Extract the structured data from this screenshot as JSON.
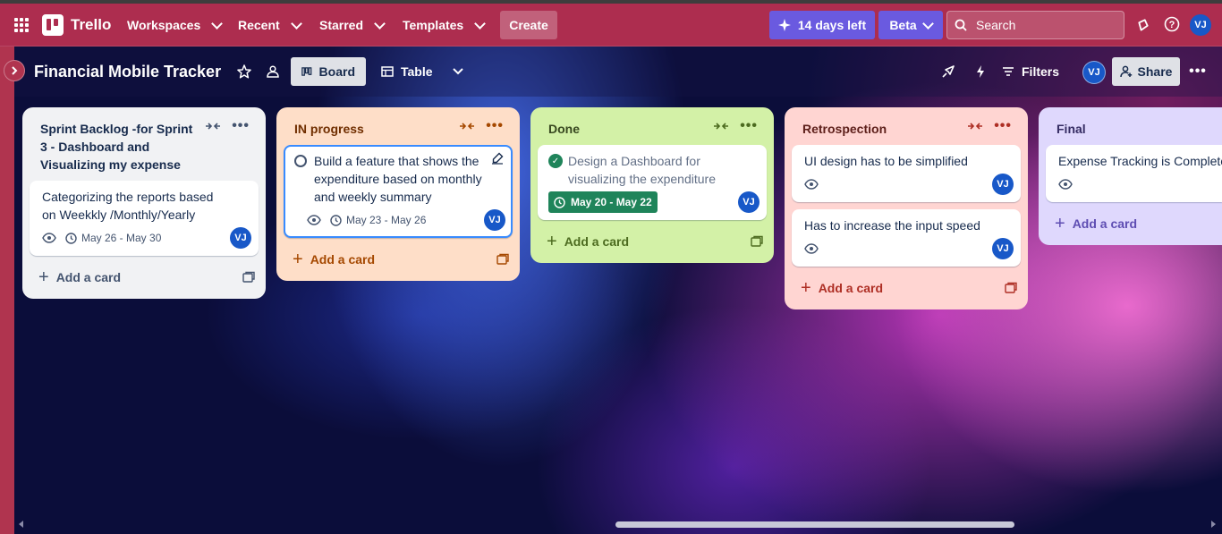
{
  "topbar": {
    "brand": "Trello",
    "nav": [
      "Workspaces",
      "Recent",
      "Starred",
      "Templates"
    ],
    "create_label": "Create",
    "trial_label": "14 days left",
    "beta_label": "Beta",
    "search_placeholder": "Search",
    "avatar_initials": "VJ"
  },
  "boardbar": {
    "title": "Financial Mobile Tracker",
    "views": {
      "board": "Board",
      "table": "Table"
    },
    "filters_label": "Filters",
    "share_label": "Share",
    "avatar_initials": "VJ"
  },
  "lists": [
    {
      "title": "Sprint Backlog -for Sprint 3 - Dashboard and Visualizing my expense",
      "color": "#f1f2f4",
      "cards": [
        {
          "title": "Categorizing the reports based on Weekkly /Monthly/Yearly",
          "date": "May 26 - May 30",
          "avatar": "VJ"
        }
      ],
      "add_label": "Add a card"
    },
    {
      "title": "IN progress",
      "color": "#fedec8",
      "cards": [
        {
          "title": "Build a feature that shows the expenditure based on monthly and weekly summary",
          "date": "May 23 - May 26",
          "avatar": "VJ"
        }
      ],
      "add_label": "Add a card"
    },
    {
      "title": "Done",
      "color": "#d3f1a7",
      "cards": [
        {
          "title": "Design a Dashboard for visualizing the expenditure",
          "date": "May 20 - May 22",
          "avatar": "VJ",
          "completed": true
        }
      ],
      "add_label": "Add a card"
    },
    {
      "title": "Retrospection",
      "color": "#ffd5d2",
      "cards": [
        {
          "title": "UI design has to be simplified",
          "avatar": "VJ"
        },
        {
          "title": "Has to increase the input speed",
          "avatar": "VJ"
        }
      ],
      "add_label": "Add a card"
    },
    {
      "title": "Final",
      "color": "#dfd8fd",
      "cards": [
        {
          "title": "Expense Tracking is Completed"
        }
      ],
      "add_label": "Add a card"
    }
  ]
}
